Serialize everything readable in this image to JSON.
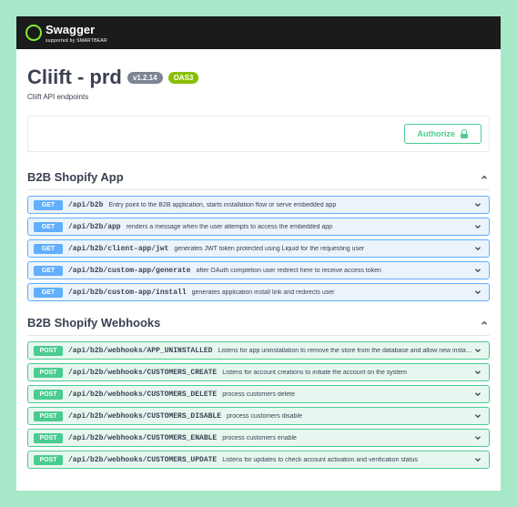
{
  "brand": {
    "name": "Swagger",
    "subtitle": "supported by SMARTBEAR"
  },
  "api": {
    "title": "Cliift - prd",
    "version": "v1.2.14",
    "oas": "OAS3",
    "description": "Cliift API endpoints"
  },
  "authorize_label": "Authorize",
  "sections": [
    {
      "name": "B2B Shopify App",
      "endpoints": [
        {
          "method": "GET",
          "path": "/api/b2b",
          "summary": "Entry point to the B2B application, starts installation flow or serve embedded app"
        },
        {
          "method": "GET",
          "path": "/api/b2b/app",
          "summary": "renders a message when the user attempts to access the embedded app"
        },
        {
          "method": "GET",
          "path": "/api/b2b/client-app/jwt",
          "summary": "generates JWT token protected using Liquid for the requesting user"
        },
        {
          "method": "GET",
          "path": "/api/b2b/custom-app/generate",
          "summary": "after OAuth completion user redirect here to receive access token"
        },
        {
          "method": "GET",
          "path": "/api/b2b/custom-app/install",
          "summary": "generates application install link and redirects user"
        }
      ]
    },
    {
      "name": "B2B Shopify Webhooks",
      "endpoints": [
        {
          "method": "POST",
          "path": "/api/b2b/webhooks/APP_UNINSTALLED",
          "summary": "Listens for app uninstallation to remove the store from the database and allow new installations"
        },
        {
          "method": "POST",
          "path": "/api/b2b/webhooks/CUSTOMERS_CREATE",
          "summary": "Listens for account creations to initiate the account on the system"
        },
        {
          "method": "POST",
          "path": "/api/b2b/webhooks/CUSTOMERS_DELETE",
          "summary": "process customers delete"
        },
        {
          "method": "POST",
          "path": "/api/b2b/webhooks/CUSTOMERS_DISABLE",
          "summary": "process customers disable"
        },
        {
          "method": "POST",
          "path": "/api/b2b/webhooks/CUSTOMERS_ENABLE",
          "summary": "process customers enable"
        },
        {
          "method": "POST",
          "path": "/api/b2b/webhooks/CUSTOMERS_UPDATE",
          "summary": "Listens for updates to check account activation and verification status"
        }
      ]
    }
  ]
}
